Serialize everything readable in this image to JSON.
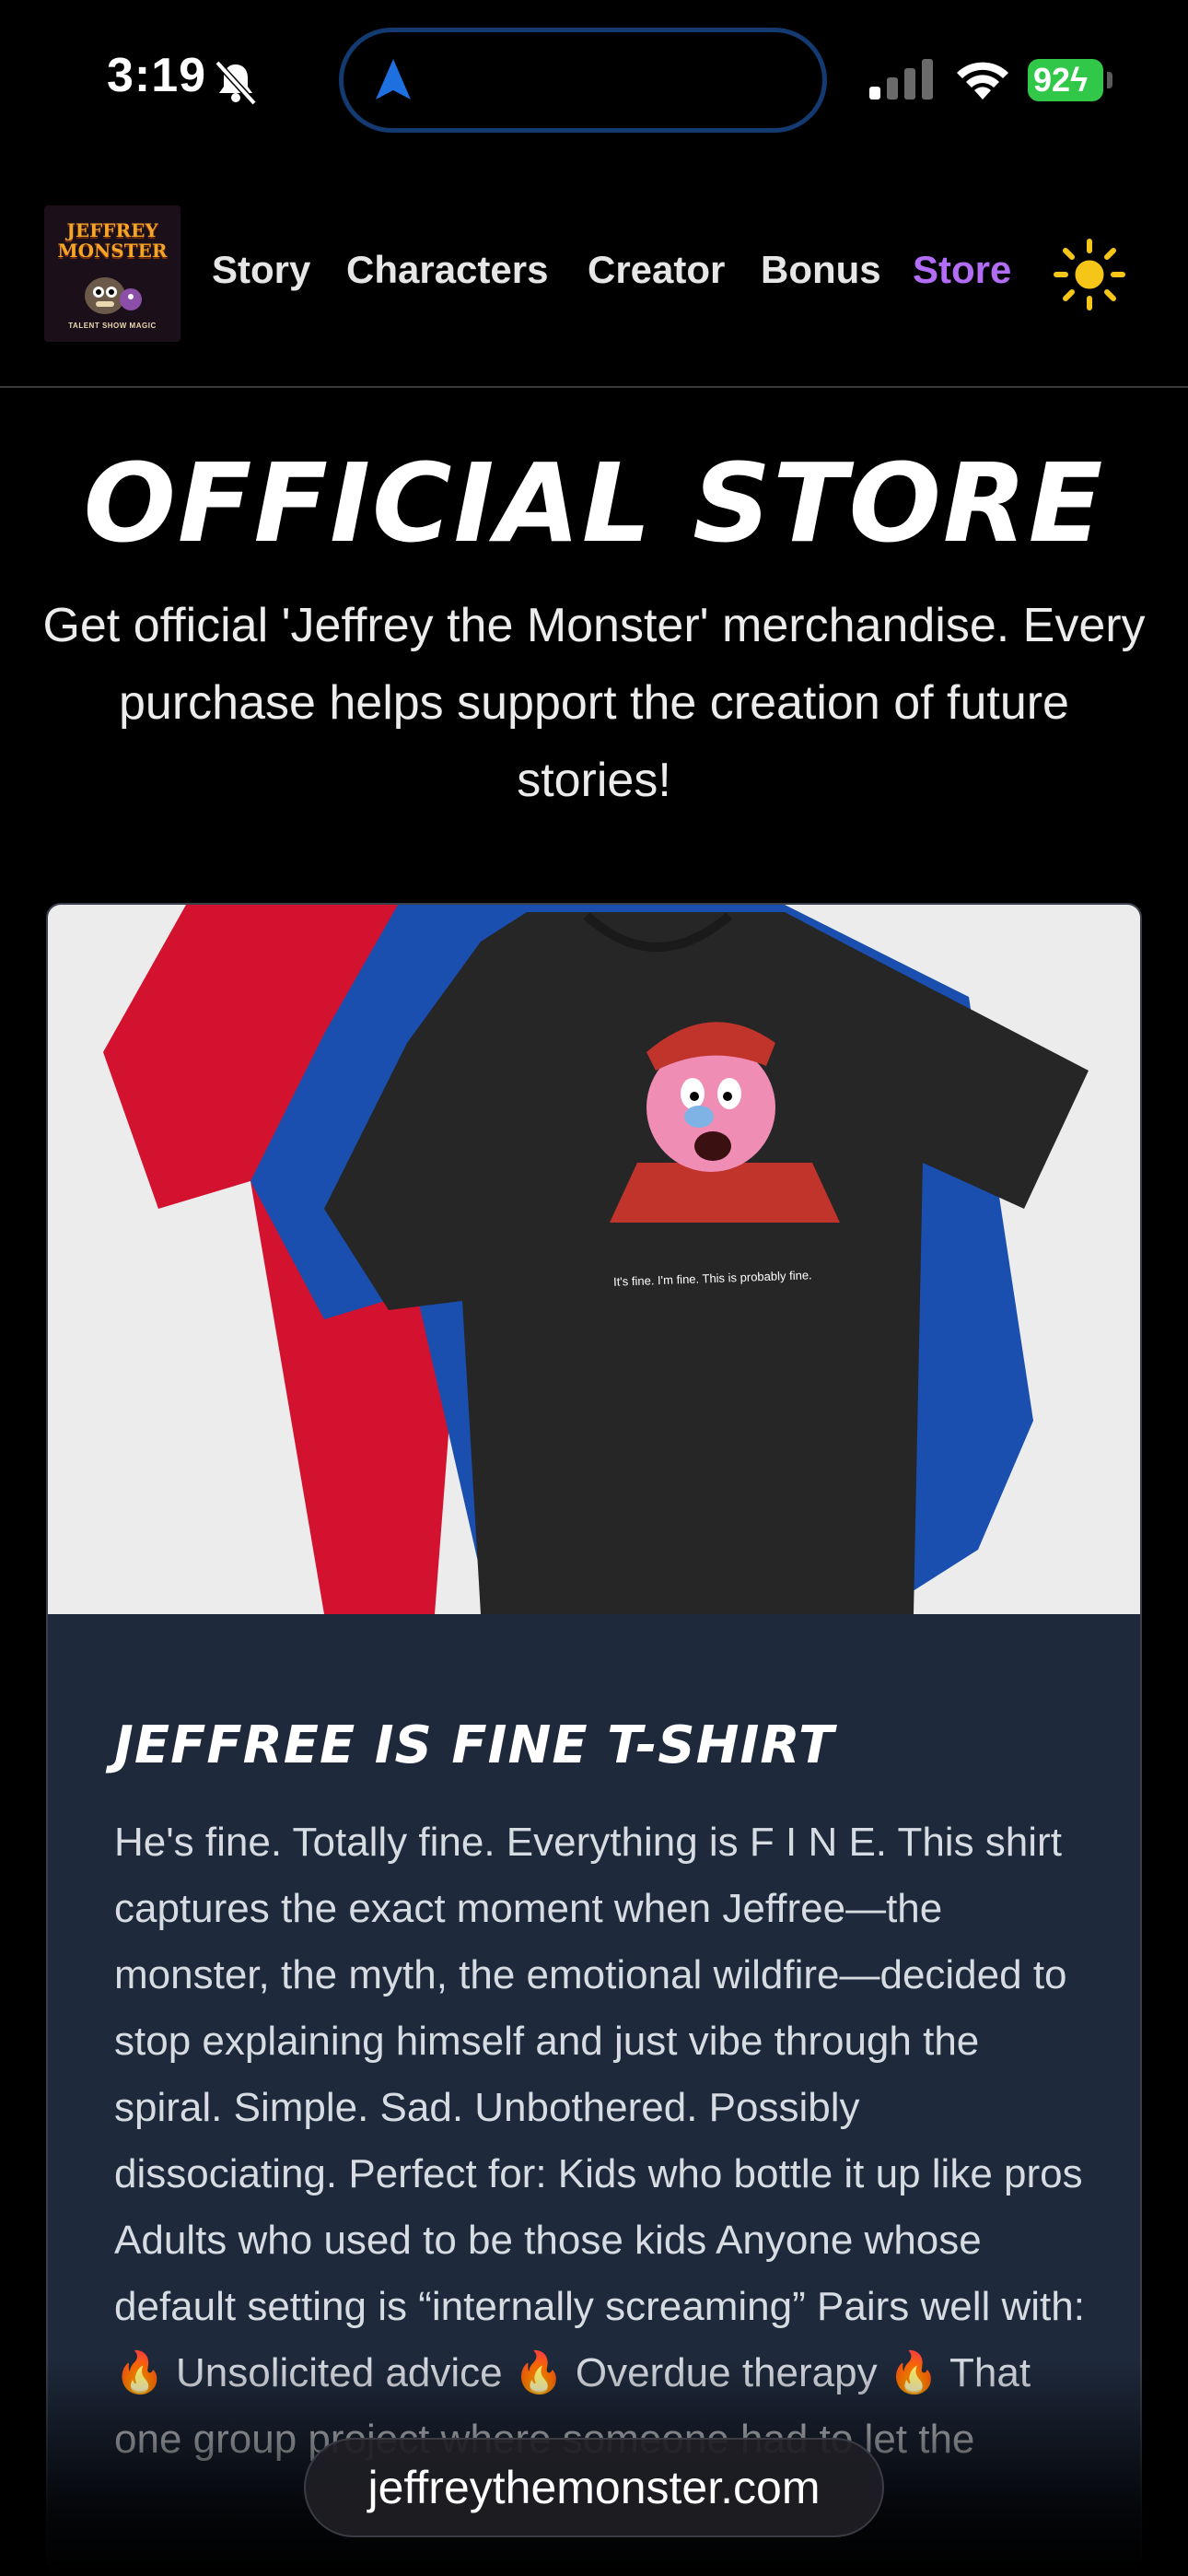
{
  "status_bar": {
    "time": "3:19",
    "battery": "92"
  },
  "header": {
    "logo": {
      "line1": "JEFFREY",
      "line2": "MONSTER",
      "tagline": "TALENT SHOW MAGIC"
    },
    "nav": [
      {
        "label": "Story"
      },
      {
        "label": "Characters"
      },
      {
        "label": "Creator"
      },
      {
        "label": "Bonus"
      },
      {
        "label": "Store",
        "active": true
      }
    ],
    "theme_icon": "sun-icon"
  },
  "main": {
    "title": "OFFICIAL STORE",
    "intro": "Get official 'Jeffrey the Monster' merchandise. Every purchase helps support the creation of future stories!",
    "product": {
      "title": "JEFFREE IS FINE T-SHIRT",
      "shirt_caption": "It's fine. I'm fine. This is probably fine.",
      "description": "He's fine. Totally fine. Everything is F I N E. This shirt captures the exact moment when Jeffree—the monster, the myth, the emotional wildfire—decided to stop explaining himself and just vibe through the spiral. Simple. Sad. Unbothered. Possibly dissociating. Perfect for: Kids who bottle it up like pros Adults who used to be those kids Anyone whose default setting is “internally screaming” Pairs well with: 🔥 Unsolicited advice 🔥 Overdue therapy 🔥 That one group project where someone had to let the"
    }
  },
  "browser": {
    "url": "jeffreythemonster.com"
  },
  "colors": {
    "accent_purple": "#b26cf6",
    "sun_yellow": "#f5c518",
    "battery_green": "#31c84a",
    "card_bg": "#1e293b",
    "island_border": "#143a72",
    "nav_arrow_blue": "#1e6fe0"
  }
}
